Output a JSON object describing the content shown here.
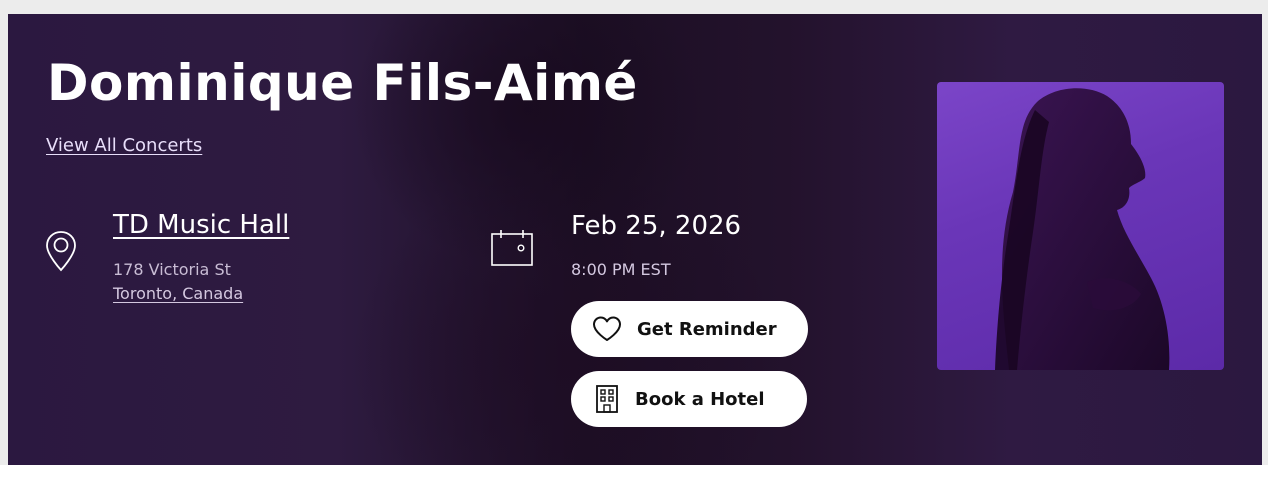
{
  "event": {
    "artist": "Dominique Fils-Aimé",
    "view_all_label": "View All Concerts",
    "venue": {
      "name": "TD Music Hall",
      "street": "178 Victoria St",
      "city": "Toronto, Canada"
    },
    "date": "Feb 25, 2026",
    "time": "8:00 PM EST"
  },
  "actions": {
    "reminder_label": "Get Reminder",
    "hotel_label": "Book a Hotel"
  },
  "icons": {
    "location": "location-pin-icon",
    "calendar": "calendar-icon",
    "reminder": "heart-icon",
    "hotel": "building-icon"
  },
  "colors": {
    "hero_background": "#2d1a3d",
    "photo_accent": "#7b45c8",
    "button_background": "#ffffff",
    "text_primary": "#ffffff"
  }
}
